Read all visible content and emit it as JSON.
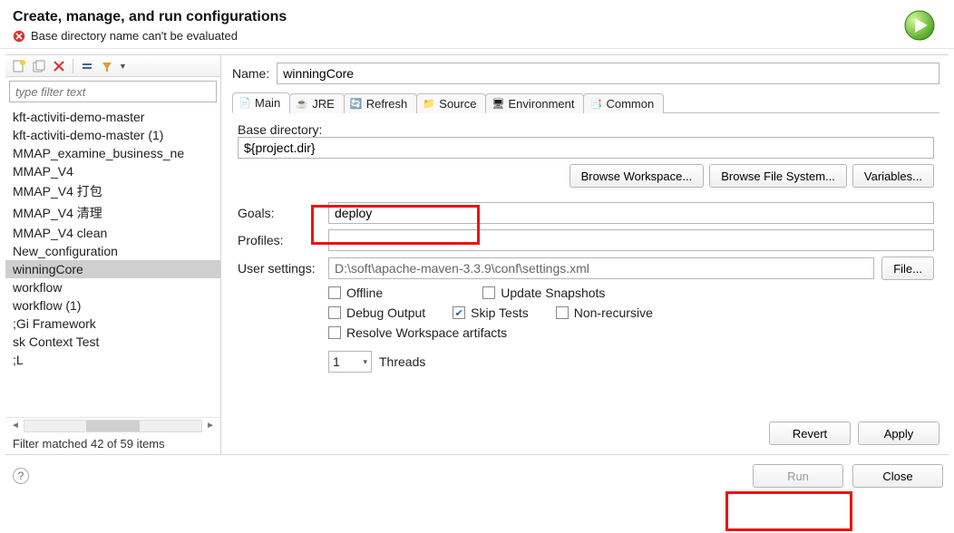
{
  "header": {
    "title": "Create, manage, and run configurations",
    "error": "Base directory name can't be evaluated"
  },
  "filter": {
    "placeholder": "type filter text",
    "status": "Filter matched 42 of 59 items"
  },
  "tree": {
    "items": [
      "kft-activiti-demo-master",
      "kft-activiti-demo-master (1)",
      "MMAP_examine_business_ne",
      "MMAP_V4",
      "MMAP_V4 打包",
      "MMAP_V4 清理",
      "MMAP_V4 clean",
      "New_configuration",
      "winningCore",
      "workflow",
      "workflow (1)",
      ";Gi Framework",
      "sk Context Test",
      ";L"
    ],
    "selected_index": 8
  },
  "form": {
    "name_label": "Name:",
    "name_value": "winningCore",
    "tabs": [
      "Main",
      "JRE",
      "Refresh",
      "Source",
      "Environment",
      "Common"
    ],
    "active_tab": 0,
    "base_directory_label": "Base directory:",
    "base_directory_value": "${project.dir}",
    "browse_workspace": "Browse Workspace...",
    "browse_filesystem": "Browse File System...",
    "variables": "Variables...",
    "goals_label": "Goals:",
    "goals_value": "deploy",
    "profiles_label": "Profiles:",
    "profiles_value": "",
    "user_settings_label": "User settings:",
    "user_settings_value": "D:\\soft\\apache-maven-3.3.9\\conf\\settings.xml",
    "file_button": "File...",
    "checks": {
      "offline": {
        "label": "Offline",
        "checked": false
      },
      "update_snapshots": {
        "label": "Update Snapshots",
        "checked": false
      },
      "debug_output": {
        "label": "Debug Output",
        "checked": false
      },
      "skip_tests": {
        "label": "Skip Tests",
        "checked": true
      },
      "non_recursive": {
        "label": "Non-recursive",
        "checked": false
      },
      "resolve_workspace": {
        "label": "Resolve Workspace artifacts",
        "checked": false
      }
    },
    "threads_label": "Threads",
    "threads_value": "1",
    "revert": "Revert",
    "apply": "Apply"
  },
  "footer": {
    "run": "Run",
    "close": "Close"
  }
}
